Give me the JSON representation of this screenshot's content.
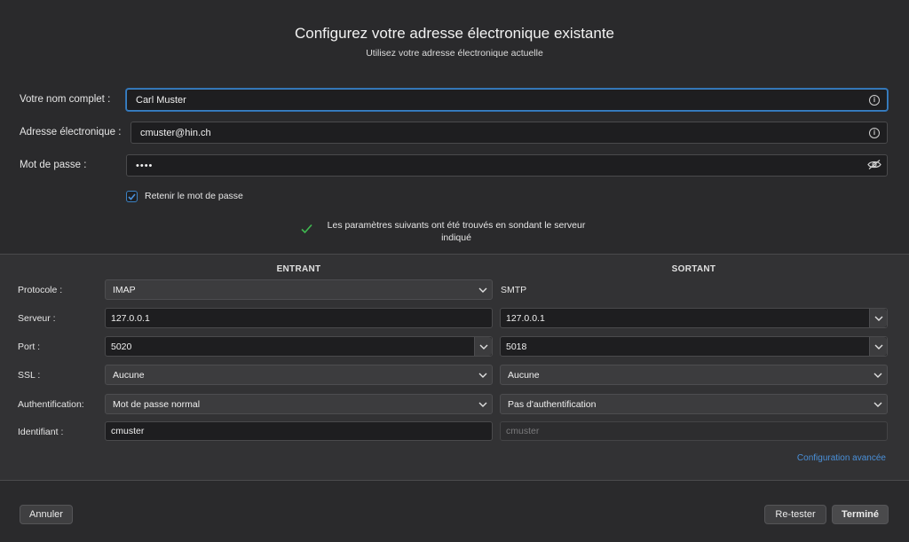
{
  "header": {
    "title": "Configurez votre adresse électronique existante",
    "subtitle": "Utilisez votre adresse électronique actuelle"
  },
  "form": {
    "fullname_label": "Votre nom complet :",
    "fullname_value": "Carl Muster",
    "email_label": "Adresse électronique :",
    "email_value": "cmuster@hin.ch",
    "password_label": "Mot de passe :",
    "password_value": "••••",
    "remember_label": "Retenir le mot de passe",
    "remember_checked": true
  },
  "status": {
    "message": "Les paramètres suivants ont été trouvés en sondant le serveur indiqué",
    "icon": "checkmark-icon",
    "color": "#3fb950"
  },
  "settings": {
    "incoming_header": "ENTRANT",
    "outgoing_header": "SORTANT",
    "rows": {
      "protocol": {
        "label": "Protocole :",
        "incoming": "IMAP",
        "outgoing": "SMTP"
      },
      "server": {
        "label": "Serveur :",
        "incoming": "127.0.0.1",
        "outgoing": "127.0.0.1"
      },
      "port": {
        "label": "Port :",
        "incoming": "5020",
        "outgoing": "5018"
      },
      "ssl": {
        "label": "SSL :",
        "incoming": "Aucune",
        "outgoing": "Aucune"
      },
      "auth": {
        "label": "Authentification:",
        "incoming": "Mot de passe normal",
        "outgoing": "Pas d'authentification"
      },
      "username": {
        "label": "Identifiant :",
        "incoming": "cmuster",
        "outgoing_placeholder": "cmuster"
      }
    },
    "advanced_link": "Configuration avancée"
  },
  "footer": {
    "cancel_label": "Annuler",
    "retest_label": "Re-tester",
    "done_label": "Terminé"
  },
  "colors": {
    "accent": "#3b82c4",
    "link": "#4a90d9",
    "background": "#2a2a2c"
  }
}
